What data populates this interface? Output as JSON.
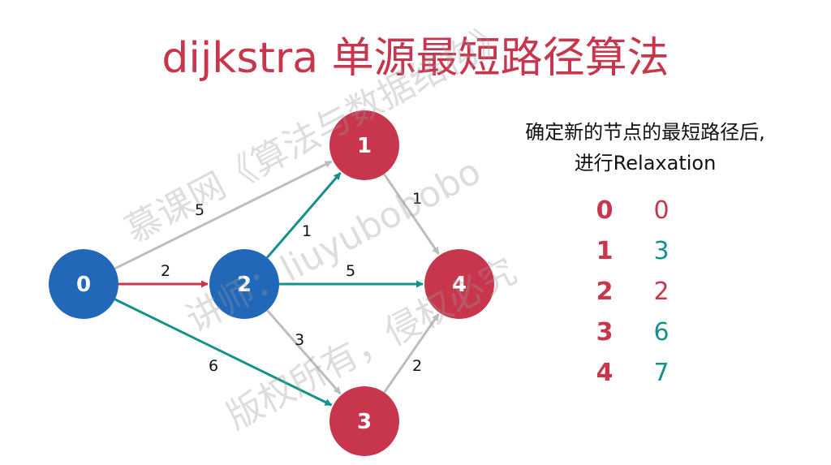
{
  "title": "dijkstra 单源最短路径算法",
  "note": {
    "line1": "确定新的节点的最短路径后,",
    "line2": "进行Relaxation"
  },
  "colors": {
    "title": "#c8364e",
    "node_done": "#2268b8",
    "node_pending": "#c8364e",
    "edge_gray": "#bdbdbd",
    "edge_red": "#c8364e",
    "edge_teal": "#149188",
    "dist_red": "#c8364e",
    "dist_teal": "#149188"
  },
  "graph": {
    "nodes": [
      {
        "id": "0",
        "label": "0",
        "state": "done"
      },
      {
        "id": "1",
        "label": "1",
        "state": "pending"
      },
      {
        "id": "2",
        "label": "2",
        "state": "done"
      },
      {
        "id": "3",
        "label": "3",
        "state": "pending"
      },
      {
        "id": "4",
        "label": "4",
        "state": "pending"
      }
    ],
    "edges": [
      {
        "from": "0",
        "to": "1",
        "weight": "5",
        "style": "gray"
      },
      {
        "from": "0",
        "to": "2",
        "weight": "2",
        "style": "red"
      },
      {
        "from": "0",
        "to": "3",
        "weight": "6",
        "style": "teal"
      },
      {
        "from": "2",
        "to": "1",
        "weight": "1",
        "style": "teal"
      },
      {
        "from": "2",
        "to": "4",
        "weight": "5",
        "style": "teal"
      },
      {
        "from": "2",
        "to": "3",
        "weight": "3",
        "style": "gray"
      },
      {
        "from": "1",
        "to": "4",
        "weight": "1",
        "style": "gray"
      },
      {
        "from": "3",
        "to": "4",
        "weight": "2",
        "style": "gray"
      }
    ]
  },
  "distances": [
    {
      "node": "0",
      "dist": "0",
      "color": "red"
    },
    {
      "node": "1",
      "dist": "3",
      "color": "teal"
    },
    {
      "node": "2",
      "dist": "2",
      "color": "red"
    },
    {
      "node": "3",
      "dist": "6",
      "color": "teal"
    },
    {
      "node": "4",
      "dist": "7",
      "color": "teal"
    }
  ],
  "watermark": {
    "line1": "慕课网《算法与数据结构》",
    "line2": "讲师：liuyubobobo",
    "line3": "版权所有，侵权必究"
  }
}
